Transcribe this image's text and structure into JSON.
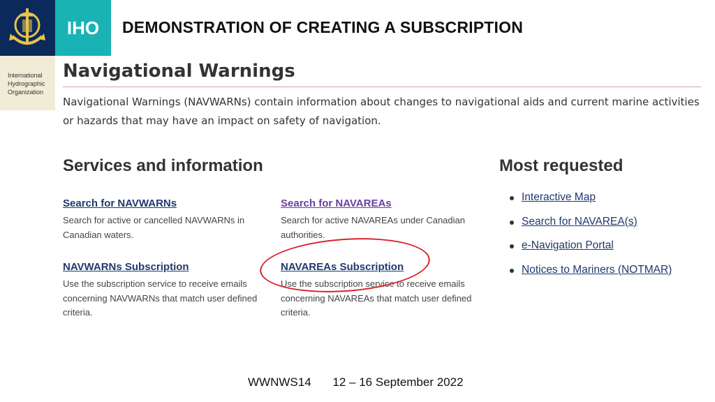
{
  "slide_title": "DEMONSTRATION OF CREATING A SUBSCRIPTION",
  "logo": {
    "abbr": "IHO",
    "org_line1": "International",
    "org_line2": "Hydrographic",
    "org_line3": "Organization"
  },
  "page": {
    "title": "Navigational Warnings",
    "description": "Navigational Warnings (NAVWARNs) contain information about changes to navigational aids and current marine activities or hazards that may have an impact on safety of navigation."
  },
  "services": {
    "heading": "Services and information",
    "items": [
      {
        "label": "Search for NAVWARNs",
        "desc": "Search for active or cancelled NAVWARNs in Canadian waters."
      },
      {
        "label": "Search for NAVAREAs",
        "desc": "Search for active NAVAREAs under Canadian authorities."
      },
      {
        "label": "NAVWARNs Subscription",
        "desc": "Use the subscription service to receive emails concerning NAVWARNs that match user defined criteria."
      },
      {
        "label": "NAVAREAs Subscription",
        "desc": "Use the subscription service to receive emails concerning NAVAREAs that match user defined criteria."
      }
    ]
  },
  "most_requested": {
    "heading": "Most requested",
    "items": [
      "Interactive Map",
      "Search for NAVAREA(s)",
      "e-Navigation Portal",
      "Notices to Mariners (NOTMAR)"
    ]
  },
  "footer": {
    "event": "WWNWS14",
    "dates": "12 – 16 September 2022"
  },
  "colors": {
    "navy": "#0b2a5b",
    "teal": "#19b3b6",
    "link": "#1f3a6e",
    "visited": "#6b3fa0",
    "highlight": "#d9202a"
  }
}
